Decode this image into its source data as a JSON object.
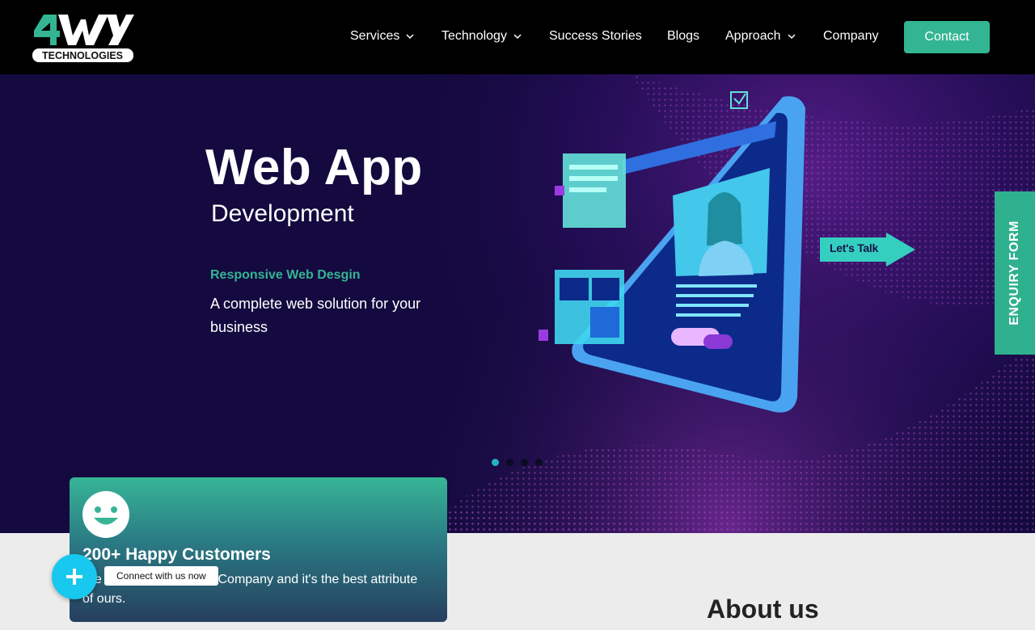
{
  "brand": {
    "logo_text": "TECHNOLOGIES",
    "logo_mark": "4WAY"
  },
  "nav": {
    "items": [
      {
        "label": "Services",
        "has_dropdown": true
      },
      {
        "label": "Technology",
        "has_dropdown": true
      },
      {
        "label": "Success Stories",
        "has_dropdown": false
      },
      {
        "label": "Blogs",
        "has_dropdown": false
      },
      {
        "label": "Approach",
        "has_dropdown": true
      },
      {
        "label": "Company",
        "has_dropdown": false
      }
    ],
    "contact_label": "Contact"
  },
  "hero": {
    "title": "Web App",
    "subtitle": "Development",
    "tagline": "Responsive Web Desgin",
    "description": "A complete web solution for your business",
    "cta": "Let's Talk",
    "slides": 4,
    "active_slide": 1
  },
  "enquiry_tab": "ENQUIRY FORM",
  "stats_card": {
    "title": "200+ Happy Customers",
    "description_visible_start": "We",
    "description_visible_end": "tric Company and it's the best attribute of ours."
  },
  "about": {
    "title": "About us"
  },
  "chat": {
    "tooltip": "Connect with us now"
  },
  "colors": {
    "accent": "#33b593",
    "hero_bg": "#140a3f",
    "fab": "#18c8ee",
    "header_bg": "#000000"
  },
  "icons": [
    "chevron-down-icon",
    "smile-icon",
    "plus-icon",
    "arrow-icon"
  ]
}
